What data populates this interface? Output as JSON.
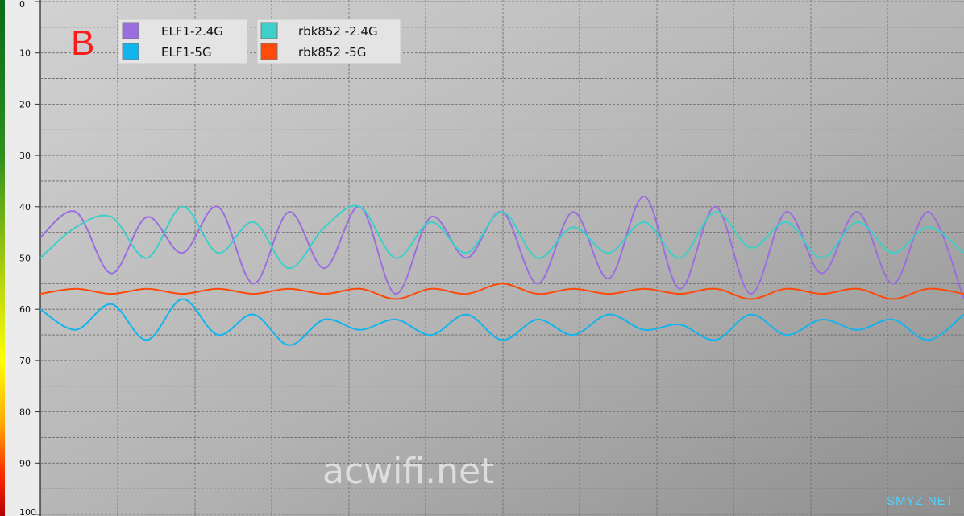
{
  "chart_data": {
    "type": "line",
    "panel_label": "B",
    "y_axis": {
      "ticks": [
        "0",
        "10",
        "20",
        "30",
        "40",
        "50",
        "60",
        "70",
        "80",
        "90",
        "100"
      ],
      "ylim": [
        0,
        100
      ],
      "inverted": true,
      "colorbar": [
        "#0a6b1a",
        "#2f8f1f",
        "#7fb51a",
        "#c9d80a",
        "#ffff00",
        "#ffb000",
        "#ff3b00",
        "#cc0000"
      ]
    },
    "grid": true,
    "legend_position": "top-left",
    "x": [
      0,
      10,
      20,
      30,
      40,
      50,
      60,
      70,
      80,
      90,
      100
    ],
    "series": [
      {
        "name": "ELF1-2.4G",
        "color": "#9b6ee0",
        "values": [
          46,
          41,
          53,
          42,
          49,
          40,
          55,
          41,
          52,
          40,
          57,
          42,
          50,
          41,
          55,
          41,
          54,
          38,
          56,
          40,
          57,
          41,
          53,
          41,
          55,
          41,
          58
        ]
      },
      {
        "name": "rbk852 -2.4G",
        "color": "#3dcfc8",
        "values": [
          50,
          44,
          42,
          50,
          40,
          49,
          43,
          52,
          44,
          40,
          50,
          43,
          49,
          41,
          50,
          44,
          49,
          43,
          50,
          41,
          48,
          43,
          50,
          43,
          49,
          44,
          49
        ]
      },
      {
        "name": "ELF1-5G",
        "color": "#12b4ee",
        "values": [
          60,
          64,
          59,
          66,
          58,
          65,
          61,
          67,
          62,
          64,
          62,
          65,
          61,
          66,
          62,
          65,
          61,
          64,
          63,
          66,
          61,
          65,
          62,
          64,
          62,
          66,
          61
        ]
      },
      {
        "name": "rbk852 -5G",
        "color": "#ff4a0a",
        "values": [
          57,
          56,
          57,
          56,
          57,
          56,
          57,
          56,
          57,
          56,
          58,
          56,
          57,
          55,
          57,
          56,
          57,
          56,
          57,
          56,
          58,
          56,
          57,
          56,
          58,
          56,
          57
        ]
      }
    ]
  },
  "watermarks": {
    "main": "acwifi.net",
    "corner": "SMYZ.NET"
  }
}
